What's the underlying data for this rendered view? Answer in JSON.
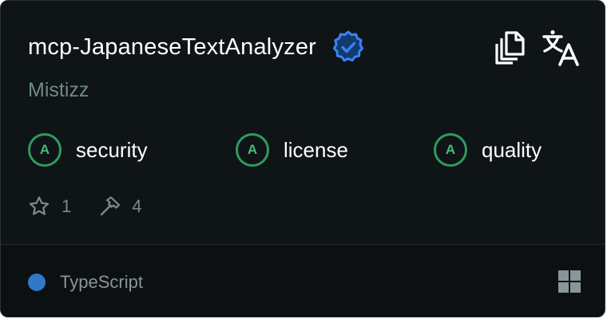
{
  "server": {
    "name": "mcp-JapaneseTextAnalyzer",
    "author": "Mistizz",
    "verified": true
  },
  "actions": {
    "copy_icon": "copy-icon",
    "translate_icon": "translate-icon"
  },
  "scores": [
    {
      "grade": "A",
      "label": "security"
    },
    {
      "grade": "A",
      "label": "license"
    },
    {
      "grade": "A",
      "label": "quality"
    }
  ],
  "stats": {
    "stars": "1",
    "tools": "4"
  },
  "footer": {
    "language": "TypeScript",
    "language_color": "#3178c6",
    "platform_icon": "windows-icon"
  },
  "colors": {
    "background": "#0f1417",
    "footer_background": "#0c1013",
    "verified_badge": "#3b82f6",
    "score_ring": "#2f9a5e",
    "author_text": "#6f8a85"
  }
}
